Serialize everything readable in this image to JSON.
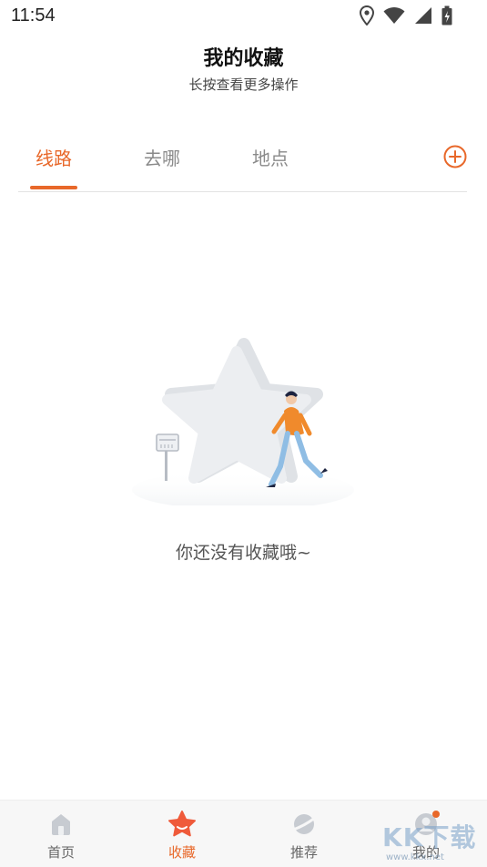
{
  "status_bar": {
    "time": "11:54",
    "icons": [
      "location-icon",
      "wifi-icon",
      "signal-icon",
      "battery-charging-icon"
    ]
  },
  "header": {
    "title": "我的收藏",
    "subtitle": "长按查看更多操作"
  },
  "tabs": [
    {
      "label": "线路",
      "active": true
    },
    {
      "label": "去哪",
      "active": false
    },
    {
      "label": "地点",
      "active": false
    }
  ],
  "add_button_icon": "add-circle-icon",
  "empty_state": {
    "illustration": "star-with-walking-person",
    "message": "你还没有收藏哦~"
  },
  "bottom_nav": [
    {
      "label": "首页",
      "icon": "home-icon",
      "active": false
    },
    {
      "label": "收藏",
      "icon": "star-icon",
      "active": true
    },
    {
      "label": "推荐",
      "icon": "planet-icon",
      "active": false
    },
    {
      "label": "我的",
      "icon": "user-icon",
      "active": false,
      "badge": true
    }
  ],
  "watermark": {
    "text": "KK下载",
    "url": "www.kkx.net"
  },
  "colors": {
    "accent": "#e8682a",
    "tab_inactive": "#8a8a8a",
    "divider": "#e3e3e3"
  }
}
